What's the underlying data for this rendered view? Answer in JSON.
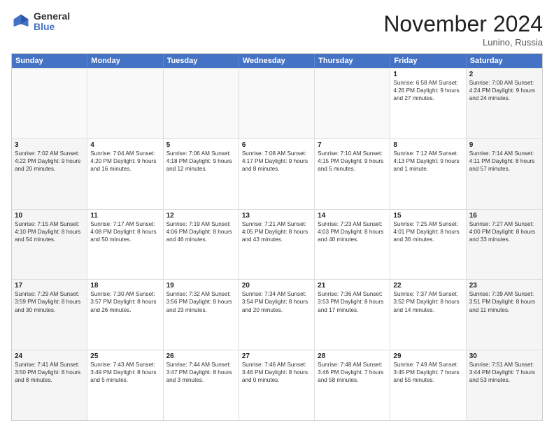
{
  "logo": {
    "general": "General",
    "blue": "Blue"
  },
  "header": {
    "month": "November 2024",
    "location": "Lunino, Russia"
  },
  "days_of_week": [
    "Sunday",
    "Monday",
    "Tuesday",
    "Wednesday",
    "Thursday",
    "Friday",
    "Saturday"
  ],
  "rows": [
    [
      {
        "num": "",
        "info": "",
        "empty": true
      },
      {
        "num": "",
        "info": "",
        "empty": true
      },
      {
        "num": "",
        "info": "",
        "empty": true
      },
      {
        "num": "",
        "info": "",
        "empty": true
      },
      {
        "num": "",
        "info": "",
        "empty": true
      },
      {
        "num": "1",
        "info": "Sunrise: 6:58 AM\nSunset: 4:26 PM\nDaylight: 9 hours and 27 minutes.",
        "empty": false
      },
      {
        "num": "2",
        "info": "Sunrise: 7:00 AM\nSunset: 4:24 PM\nDaylight: 9 hours and 24 minutes.",
        "empty": false
      }
    ],
    [
      {
        "num": "3",
        "info": "Sunrise: 7:02 AM\nSunset: 4:22 PM\nDaylight: 9 hours and 20 minutes.",
        "empty": false
      },
      {
        "num": "4",
        "info": "Sunrise: 7:04 AM\nSunset: 4:20 PM\nDaylight: 9 hours and 16 minutes.",
        "empty": false
      },
      {
        "num": "5",
        "info": "Sunrise: 7:06 AM\nSunset: 4:18 PM\nDaylight: 9 hours and 12 minutes.",
        "empty": false
      },
      {
        "num": "6",
        "info": "Sunrise: 7:08 AM\nSunset: 4:17 PM\nDaylight: 9 hours and 8 minutes.",
        "empty": false
      },
      {
        "num": "7",
        "info": "Sunrise: 7:10 AM\nSunset: 4:15 PM\nDaylight: 9 hours and 5 minutes.",
        "empty": false
      },
      {
        "num": "8",
        "info": "Sunrise: 7:12 AM\nSunset: 4:13 PM\nDaylight: 9 hours and 1 minute.",
        "empty": false
      },
      {
        "num": "9",
        "info": "Sunrise: 7:14 AM\nSunset: 4:11 PM\nDaylight: 8 hours and 57 minutes.",
        "empty": false
      }
    ],
    [
      {
        "num": "10",
        "info": "Sunrise: 7:15 AM\nSunset: 4:10 PM\nDaylight: 8 hours and 54 minutes.",
        "empty": false
      },
      {
        "num": "11",
        "info": "Sunrise: 7:17 AM\nSunset: 4:08 PM\nDaylight: 8 hours and 50 minutes.",
        "empty": false
      },
      {
        "num": "12",
        "info": "Sunrise: 7:19 AM\nSunset: 4:06 PM\nDaylight: 8 hours and 46 minutes.",
        "empty": false
      },
      {
        "num": "13",
        "info": "Sunrise: 7:21 AM\nSunset: 4:05 PM\nDaylight: 8 hours and 43 minutes.",
        "empty": false
      },
      {
        "num": "14",
        "info": "Sunrise: 7:23 AM\nSunset: 4:03 PM\nDaylight: 8 hours and 40 minutes.",
        "empty": false
      },
      {
        "num": "15",
        "info": "Sunrise: 7:25 AM\nSunset: 4:01 PM\nDaylight: 8 hours and 36 minutes.",
        "empty": false
      },
      {
        "num": "16",
        "info": "Sunrise: 7:27 AM\nSunset: 4:00 PM\nDaylight: 8 hours and 33 minutes.",
        "empty": false
      }
    ],
    [
      {
        "num": "17",
        "info": "Sunrise: 7:29 AM\nSunset: 3:59 PM\nDaylight: 8 hours and 30 minutes.",
        "empty": false
      },
      {
        "num": "18",
        "info": "Sunrise: 7:30 AM\nSunset: 3:57 PM\nDaylight: 8 hours and 26 minutes.",
        "empty": false
      },
      {
        "num": "19",
        "info": "Sunrise: 7:32 AM\nSunset: 3:56 PM\nDaylight: 8 hours and 23 minutes.",
        "empty": false
      },
      {
        "num": "20",
        "info": "Sunrise: 7:34 AM\nSunset: 3:54 PM\nDaylight: 8 hours and 20 minutes.",
        "empty": false
      },
      {
        "num": "21",
        "info": "Sunrise: 7:36 AM\nSunset: 3:53 PM\nDaylight: 8 hours and 17 minutes.",
        "empty": false
      },
      {
        "num": "22",
        "info": "Sunrise: 7:37 AM\nSunset: 3:52 PM\nDaylight: 8 hours and 14 minutes.",
        "empty": false
      },
      {
        "num": "23",
        "info": "Sunrise: 7:39 AM\nSunset: 3:51 PM\nDaylight: 8 hours and 11 minutes.",
        "empty": false
      }
    ],
    [
      {
        "num": "24",
        "info": "Sunrise: 7:41 AM\nSunset: 3:50 PM\nDaylight: 8 hours and 8 minutes.",
        "empty": false
      },
      {
        "num": "25",
        "info": "Sunrise: 7:43 AM\nSunset: 3:49 PM\nDaylight: 8 hours and 5 minutes.",
        "empty": false
      },
      {
        "num": "26",
        "info": "Sunrise: 7:44 AM\nSunset: 3:47 PM\nDaylight: 8 hours and 3 minutes.",
        "empty": false
      },
      {
        "num": "27",
        "info": "Sunrise: 7:46 AM\nSunset: 3:46 PM\nDaylight: 8 hours and 0 minutes.",
        "empty": false
      },
      {
        "num": "28",
        "info": "Sunrise: 7:48 AM\nSunset: 3:46 PM\nDaylight: 7 hours and 58 minutes.",
        "empty": false
      },
      {
        "num": "29",
        "info": "Sunrise: 7:49 AM\nSunset: 3:45 PM\nDaylight: 7 hours and 55 minutes.",
        "empty": false
      },
      {
        "num": "30",
        "info": "Sunrise: 7:51 AM\nSunset: 3:44 PM\nDaylight: 7 hours and 53 minutes.",
        "empty": false
      }
    ]
  ]
}
